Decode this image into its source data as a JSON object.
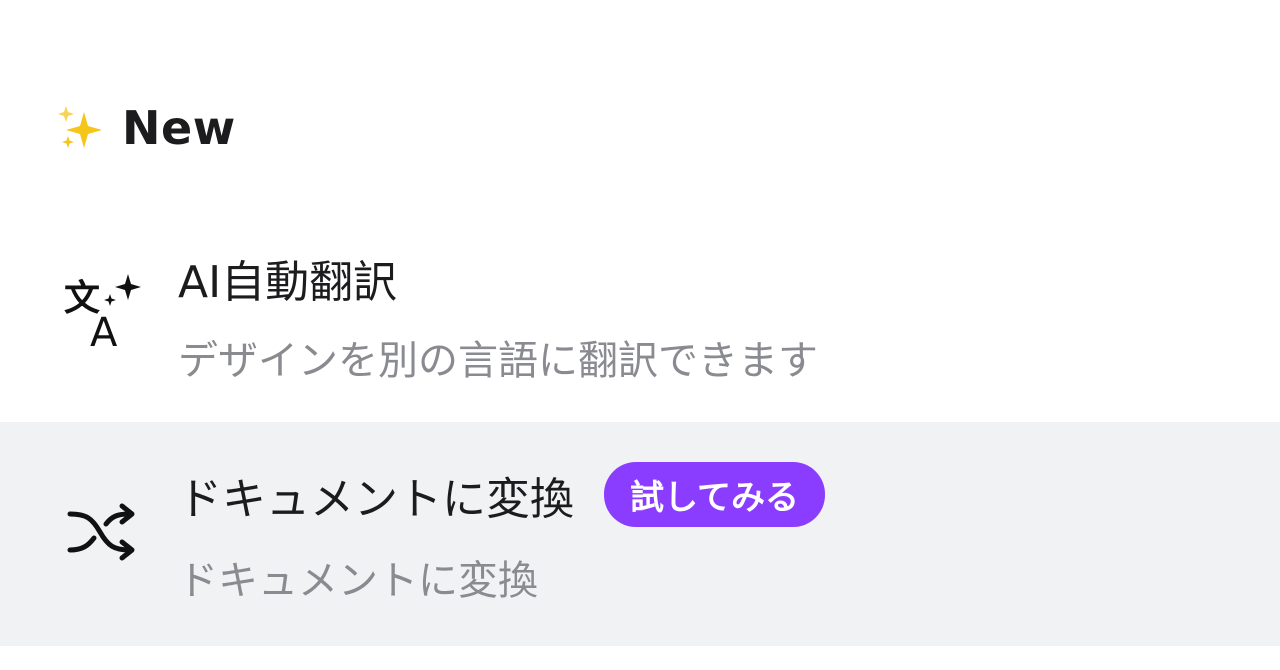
{
  "section": {
    "icon": "sparkles-icon",
    "title": "New"
  },
  "items": [
    {
      "icon": "translate-sparkle-icon",
      "title": "AI自動翻訳",
      "description": "デザインを別の言語に翻訳できます"
    },
    {
      "icon": "shuffle-icon",
      "title": "ドキュメントに変換",
      "badge": "試してみる",
      "description": "ドキュメントに変換"
    }
  ],
  "colors": {
    "badge_bg": "#8b3dff",
    "highlight_row_bg": "#f1f2f4",
    "title_text": "#1c1c1f",
    "desc_text": "#8a8b90",
    "sparkle": "#f5c518"
  }
}
